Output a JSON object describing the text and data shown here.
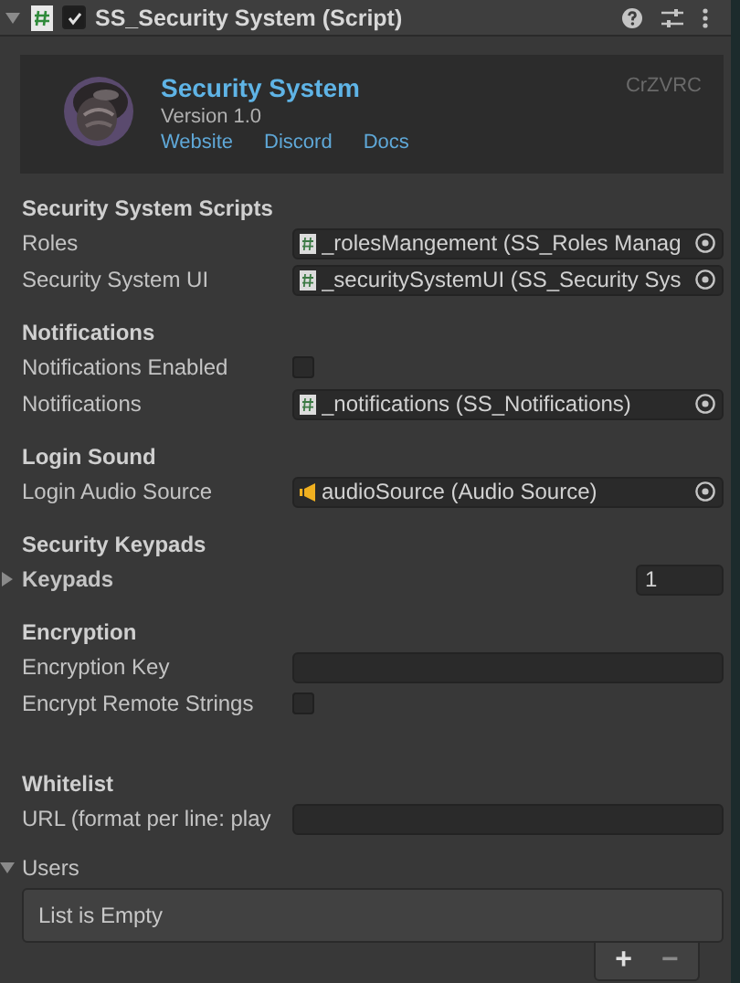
{
  "component": {
    "title": "SS_Security System (Script)",
    "expanded": true,
    "enabled": true
  },
  "banner": {
    "title": "Security System",
    "version": "Version 1.0",
    "links": [
      "Website",
      "Discord",
      "Docs"
    ],
    "author": "CrZVRC"
  },
  "sections": [
    {
      "heading": "Security System Scripts",
      "rows": [
        {
          "kind": "script_ref",
          "label": "Roles",
          "value": "_rolesMangement (SS_Roles Manag"
        },
        {
          "kind": "script_ref",
          "label": "Security System UI",
          "value": "_securitySystemUI (SS_Security Sys"
        }
      ]
    },
    {
      "heading": "Notifications",
      "rows": [
        {
          "kind": "checkbox",
          "label": "Notifications Enabled",
          "checked": false
        },
        {
          "kind": "script_ref",
          "label": "Notifications",
          "value": "_notifications (SS_Notifications)"
        }
      ]
    },
    {
      "heading": "Login Sound",
      "rows": [
        {
          "kind": "audio_ref",
          "label": "Login Audio Source",
          "value": "audioSource (Audio Source)"
        }
      ]
    },
    {
      "heading": "Security Keypads",
      "rows": [
        {
          "kind": "array",
          "label": "Keypads",
          "expanded": false,
          "value": "1"
        }
      ]
    },
    {
      "heading": "Encryption",
      "rows": [
        {
          "kind": "text",
          "label": "Encryption Key"
        },
        {
          "kind": "checkbox",
          "label": "Encrypt Remote Strings",
          "checked": false
        }
      ]
    },
    {
      "heading": "Whitelist",
      "rows": [
        {
          "kind": "text",
          "label": "URL (format per line: play"
        },
        {
          "kind": "list",
          "label": "Users",
          "expanded": true,
          "empty_text": "List is Empty",
          "buttons": [
            "+",
            "−"
          ]
        }
      ]
    }
  ]
}
